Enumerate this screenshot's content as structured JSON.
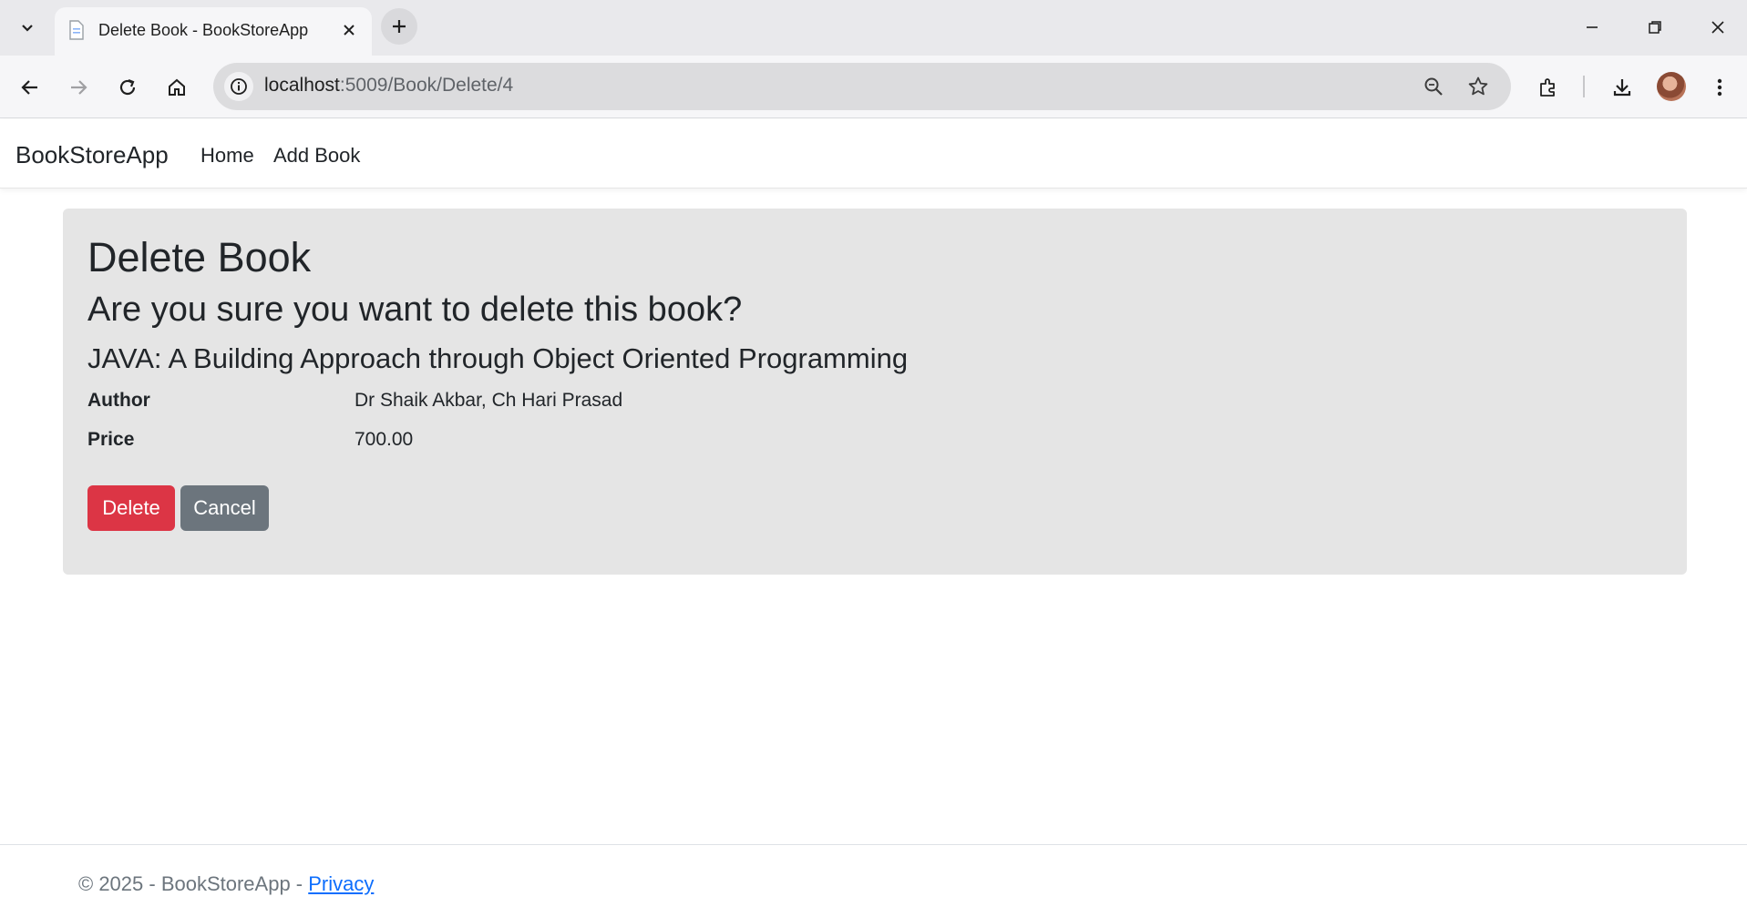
{
  "browser": {
    "tab_title": "Delete Book - BookStoreApp",
    "url_host": "localhost",
    "url_path": ":5009/Book/Delete/4"
  },
  "navbar": {
    "brand": "BookStoreApp",
    "links": [
      "Home",
      "Add Book"
    ]
  },
  "main": {
    "title": "Delete Book",
    "question": "Are you sure you want to delete this book?",
    "book_title": "JAVA: A Building Approach through Object Oriented Programming",
    "fields": [
      {
        "label": "Author",
        "value": "Dr Shaik Akbar, Ch Hari Prasad"
      },
      {
        "label": "Price",
        "value": "700.00"
      }
    ],
    "delete_label": "Delete",
    "cancel_label": "Cancel"
  },
  "footer": {
    "text": "© 2025 - BookStoreApp - ",
    "privacy_label": "Privacy"
  },
  "colors": {
    "card_bg": "#e5e5e5",
    "delete": "#dc3545",
    "cancel": "#6c757d",
    "link": "#0d6efd"
  },
  "icons": [
    "tab-search-icon",
    "page-favicon-icon",
    "close-icon",
    "plus-icon",
    "minimize-icon",
    "restore-icon",
    "window-close-icon",
    "back-icon",
    "forward-icon",
    "reload-icon",
    "home-icon",
    "site-info-icon",
    "zoom-icon",
    "star-icon",
    "extensions-icon",
    "download-icon",
    "menu-icon"
  ]
}
